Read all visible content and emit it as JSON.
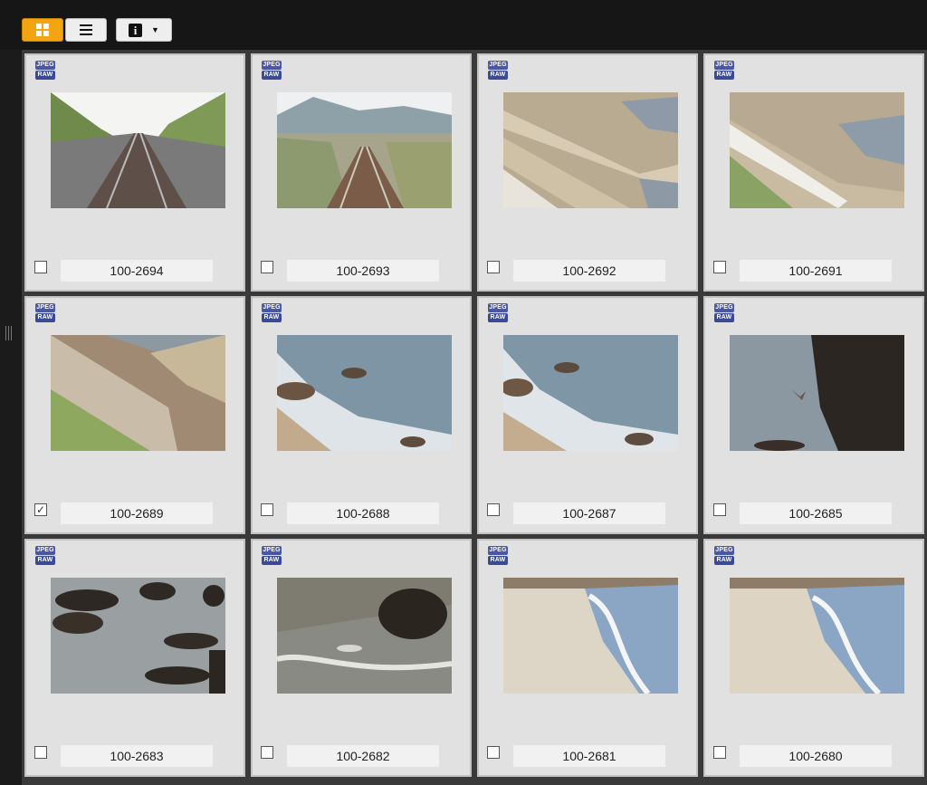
{
  "toolbar": {
    "grid_view_icon": "grid-icon",
    "list_view_icon": "list-icon",
    "info_icon": "info-icon",
    "info_glyph": "i",
    "dropdown_caret": "▼",
    "accent_color": "#f2a412"
  },
  "badges": {
    "jpeg": "JPEG",
    "raw": "RAW"
  },
  "thumbnails": [
    {
      "name": "100-2694",
      "checked": false
    },
    {
      "name": "100-2693",
      "checked": false
    },
    {
      "name": "100-2692",
      "checked": false
    },
    {
      "name": "100-2691",
      "checked": false
    },
    {
      "name": "100-2689",
      "checked": true
    },
    {
      "name": "100-2688",
      "checked": false
    },
    {
      "name": "100-2687",
      "checked": false
    },
    {
      "name": "100-2685",
      "checked": false
    },
    {
      "name": "100-2683",
      "checked": false
    },
    {
      "name": "100-2682",
      "checked": false
    },
    {
      "name": "100-2681",
      "checked": false
    },
    {
      "name": "100-2680",
      "checked": false
    }
  ]
}
